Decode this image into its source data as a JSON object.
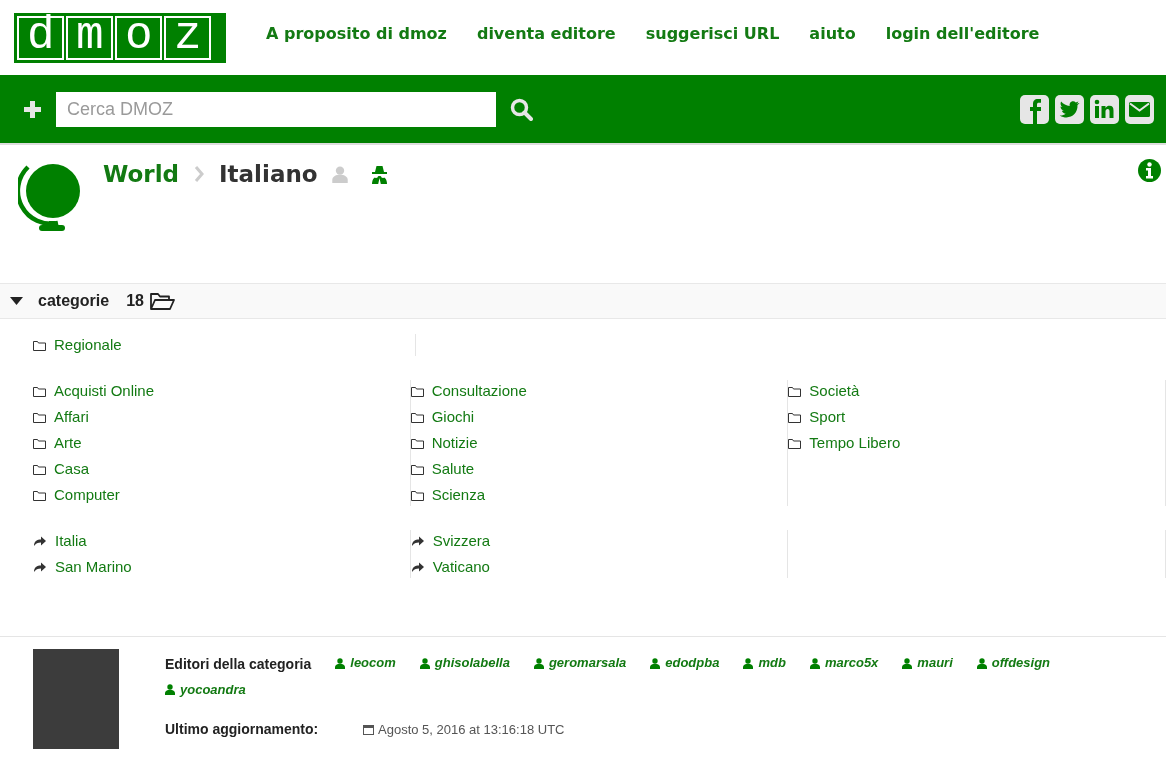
{
  "logo": "dmoz",
  "nav": [
    "A proposito di dmoz",
    "diventa editore",
    "suggerisci URL",
    "aiuto",
    "login dell'editore"
  ],
  "search": {
    "placeholder": "Cerca DMOZ"
  },
  "breadcrumb": [
    "World",
    "Italiano"
  ],
  "categories": {
    "label": "categorie",
    "count": "18",
    "expanded": true
  },
  "groups": [
    {
      "kind": "folder",
      "columns": [
        [
          "Regionale"
        ]
      ]
    },
    {
      "kind": "folder",
      "columns": [
        [
          "Acquisti Online",
          "Affari",
          "Arte",
          "Casa",
          "Computer"
        ],
        [
          "Consultazione",
          "Giochi",
          "Notizie",
          "Salute",
          "Scienza"
        ],
        [
          "Società",
          "Sport",
          "Tempo Libero"
        ]
      ]
    },
    {
      "kind": "related",
      "columns": [
        [
          "Italia",
          "San Marino"
        ],
        [
          "Svizzera",
          "Vaticano"
        ]
      ]
    }
  ],
  "editors": {
    "label": "Editori della categoria",
    "names": [
      "leocom",
      "ghisolabella",
      "geromarsala",
      "edodpba",
      "mdb",
      "marco5x",
      "mauri",
      "offdesign",
      "yocoandra"
    ]
  },
  "last_update": {
    "label": "Ultimo aggiornamento:",
    "value": "Agosto 5, 2016 at 13:16:18 UTC"
  }
}
